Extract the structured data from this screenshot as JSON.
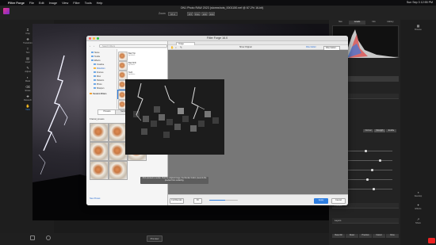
{
  "menubar": {
    "app": "Filter Forge",
    "items": [
      "File",
      "Edit",
      "Image",
      "View",
      "Filter",
      "Tools",
      "Help"
    ],
    "status": "Sun Sep 3   12:55 PM"
  },
  "document": {
    "title": "ON1 Photo RAW 2023 (stormshots_0001150.nef @ 67.2% 16-bit)",
    "zoom_label": "Zoom",
    "zoom_value": "67.2",
    "zoom_buttons": [
      "FIT",
      "FILL",
      "100",
      "200"
    ]
  },
  "left_tools": [
    {
      "name": "crop",
      "label": "Crop",
      "icon": "⌗"
    },
    {
      "name": "transform",
      "label": "Transform",
      "icon": "✥"
    },
    {
      "name": "text",
      "label": "Text",
      "icon": "T"
    },
    {
      "name": "layers",
      "label": "Layer",
      "icon": "▤"
    },
    {
      "name": "brush",
      "label": "Adjust",
      "icon": "✎"
    },
    {
      "name": "masking",
      "label": "Mask",
      "icon": "◐"
    },
    {
      "name": "perfect-eraser",
      "label": "Erase",
      "icon": "⌫"
    },
    {
      "name": "retouch",
      "label": "Retouch",
      "icon": "✚"
    },
    {
      "name": "view",
      "label": "View",
      "icon": "✋"
    },
    {
      "name": "portrait",
      "label": "Portrait",
      "icon": "☺"
    },
    {
      "name": "clone",
      "label": "Clone",
      "icon": "⌖"
    }
  ],
  "right_tools": [
    {
      "name": "browse",
      "label": "Browse",
      "icon": "▦"
    },
    {
      "name": "develop",
      "label": "Develop",
      "icon": "◑"
    },
    {
      "name": "effects",
      "label": "Effects",
      "icon": "✦"
    },
    {
      "name": "share",
      "label": "Share",
      "icon": "↗"
    }
  ],
  "right_panel": {
    "tabs": [
      "Nav",
      "Levels",
      "Info",
      "History"
    ],
    "section_labels": [
      "Filters",
      "Details",
      "Presets",
      "Layers"
    ],
    "buttons": [
      "Normal",
      "Strength",
      "Enable"
    ],
    "bottom_buttons": [
      "Reset All",
      "Reset",
      "Previous",
      "Cancel",
      "Done"
    ]
  },
  "bottom_bar": {
    "preview_label": "Preview"
  },
  "filterforge": {
    "title": "Filter Forge 16.0",
    "search_placeholder": "Search Filters",
    "tree": [
      "Stone",
      "Textile",
      "Effects",
      "Creative",
      "Distortion",
      "Frames",
      "Misc",
      "Patterns",
      "Photo",
      "Sharpen"
    ],
    "tree_special": "Custom Filters",
    "filters": [
      {
        "name": "Bad Trip",
        "sub": "by Author"
      },
      {
        "name": "Bad Shift",
        "sub": "by Author"
      },
      {
        "name": "Swirl",
        "sub": "by Author"
      },
      {
        "name": "Bubbles",
        "sub": "by Author"
      },
      {
        "name": "Dissolve",
        "sub": "by Author"
      },
      {
        "name": "Emboss Spiral",
        "sub": "by Author"
      }
    ],
    "tabs": [
      "Presets",
      "Settings",
      "About"
    ],
    "presets_label": "8 factory presets",
    "new_preset": "New Preset",
    "preview_tab": "Image",
    "toolbar_buttons": [
      "Show Original",
      "Filter Editor",
      "Filter Editor..."
    ],
    "preview_note": "Click preview to render. Hold the original image; the Render button prevents the preview from rendering.",
    "bottom": {
      "before_label": "Before",
      "progress": 0.55,
      "apply": "Apply",
      "cancel": "Cancel",
      "zoom": "Fit",
      "mode": "Full Render"
    }
  }
}
